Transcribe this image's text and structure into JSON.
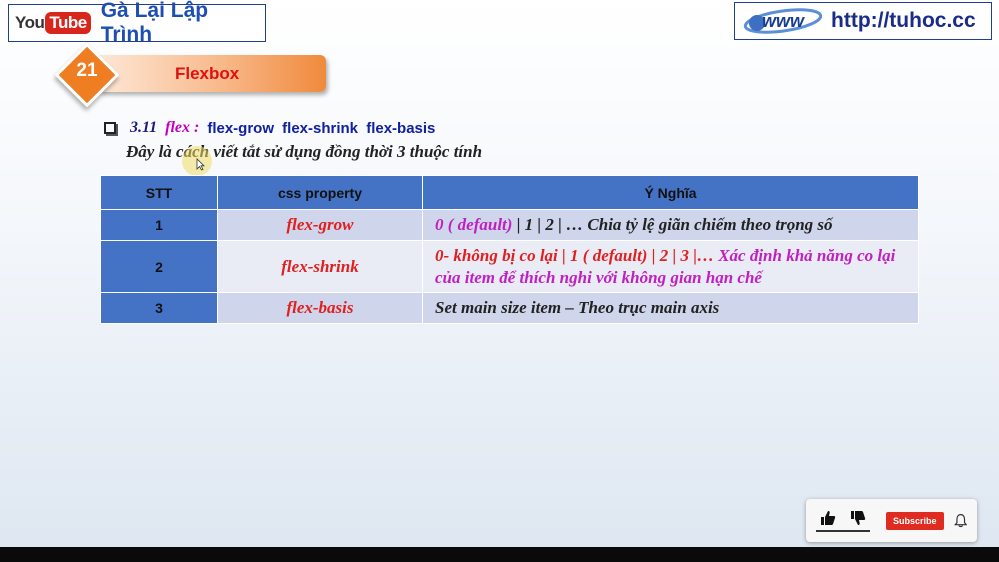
{
  "channel": {
    "logo_you": "You",
    "logo_tube": "Tube",
    "name": "Gà Lại Lập Trình"
  },
  "site": {
    "logo_text": "www",
    "url": "http://tuhoc.cc"
  },
  "lesson": {
    "number": "21",
    "title": "Flexbox"
  },
  "section": {
    "number": "3.11",
    "keyword": "flex :",
    "properties": "flex-grow  flex-shrink  flex-basis",
    "description": "Đây là cách viết tắt sử dụng đồng thời 3 thuộc tính"
  },
  "table": {
    "headers": [
      "STT",
      "css property",
      "Ý Nghĩa"
    ],
    "rows": [
      {
        "stt": "1",
        "property": "flex-grow",
        "desc_highlight": "0 ( default)",
        "desc_rest": " |  1 | 2 | … Chia tỷ lệ giãn chiếm theo trọng số"
      },
      {
        "stt": "2",
        "property": "flex-shrink",
        "desc_highlight": "0- không bị co lại | 1 ( default) |  2 | 3 |…",
        "desc_rest": "  Xác định khả năng co lại của item để thích nghi với không gian hạn chế"
      },
      {
        "stt": "3",
        "property": "flex-basis",
        "desc_highlight": "",
        "desc_rest": "Set main size item – Theo trục main axis"
      }
    ]
  },
  "widget": {
    "subscribe_label": "Subscribe"
  },
  "colors": {
    "accent_orange": "#ef7e23",
    "table_header": "#4472c4",
    "row_odd": "#cfd5ea",
    "row_even": "#e9ebf5",
    "property_red": "#e02020",
    "highlight_magenta": "#c020c0"
  },
  "icons": [
    "checkbox-icon",
    "cursor-icon",
    "thumbs-up-icon",
    "thumbs-down-icon",
    "bell-icon"
  ]
}
